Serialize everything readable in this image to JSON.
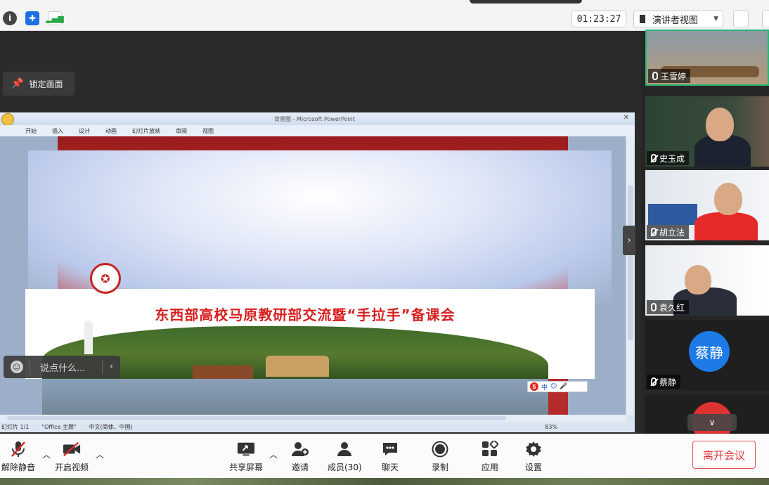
{
  "topbar": {
    "timer": "01:23:27",
    "view_mode": "演讲者视图"
  },
  "stage": {
    "lock_label": "锁定画面",
    "chat_placeholder": "说点什么...",
    "ppt": {
      "window_title": "背景图 - Microsoft PowerPoint",
      "ribbon_tabs": [
        "开始",
        "插入",
        "设计",
        "动画",
        "幻灯片放映",
        "审阅",
        "视图"
      ],
      "slide_title": "东西部高校马原教研部交流暨“手拉手”备课会",
      "status_slide": "幻灯片 1/1",
      "status_theme": "\"Office 主题\"",
      "status_lang": "中文(简体，中国)",
      "zoom": "83%",
      "ime_label": "中"
    }
  },
  "participants": [
    {
      "name": "王雪婷"
    },
    {
      "name": "史玉成"
    },
    {
      "name": "胡立法"
    },
    {
      "name": "袁久红"
    },
    {
      "name": "蔡静",
      "avatar_text": "蔡静"
    }
  ],
  "toolbar": {
    "unmute": "解除静音",
    "start_video": "开启视频",
    "share_screen": "共享屏幕",
    "invite": "邀请",
    "members": "成员(30)",
    "chat": "聊天",
    "record": "录制",
    "apps": "应用",
    "settings": "设置",
    "leave": "离开会议"
  },
  "colors": {
    "leave_red": "#e03b3b",
    "avatar_blue": "#1e7ae6",
    "slide_title_red": "#d71f1f"
  }
}
